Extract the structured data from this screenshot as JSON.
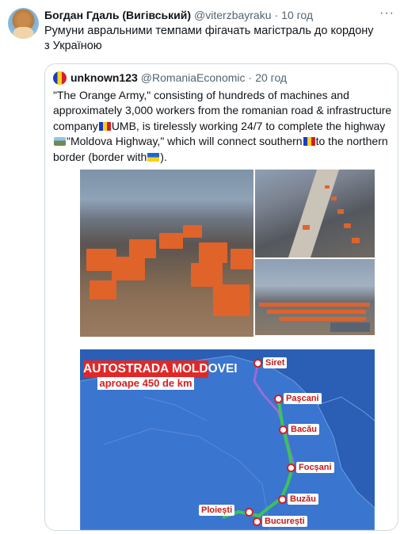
{
  "tweet": {
    "author_name": "Богдан Гдаль (Вигівський)",
    "author_handle": "@viterzbayraku",
    "separator": "·",
    "time": "10 год",
    "more_label": "···",
    "text": "Румуни авральними темпами фігачать магістраль до кордону з Україною"
  },
  "quote": {
    "author_name": "unknown123",
    "author_handle": "@RomaniaEconomic",
    "separator": "·",
    "time": "20 год",
    "text_parts": {
      "p1": "\"The Orange Army,\" consisting of hundreds of machines and approximately 3,000 workers from the romanian road & infrastructure company",
      "p2": "UMB, is tirelessly working 24/7 to complete the highway ",
      "p3": "\"Moldova Highway,\" which will connect southern",
      "p4": "to the northern border (border with",
      "p5": ")."
    },
    "map": {
      "banner_title": "AUTOSTRADA MOLDOVEI",
      "banner_subtitle": "aproape 450 de km",
      "cities": [
        "Siret",
        "Paşcani",
        "Bacău",
        "Focșani",
        "Buzău",
        "Ploiești",
        "București"
      ]
    }
  },
  "colors": {
    "map_sea": "#2a5fb5",
    "route_green": "#3cc35a",
    "route_purple": "#9b6bd9",
    "banner_red": "#e12828",
    "truck_orange": "#e0632a"
  }
}
